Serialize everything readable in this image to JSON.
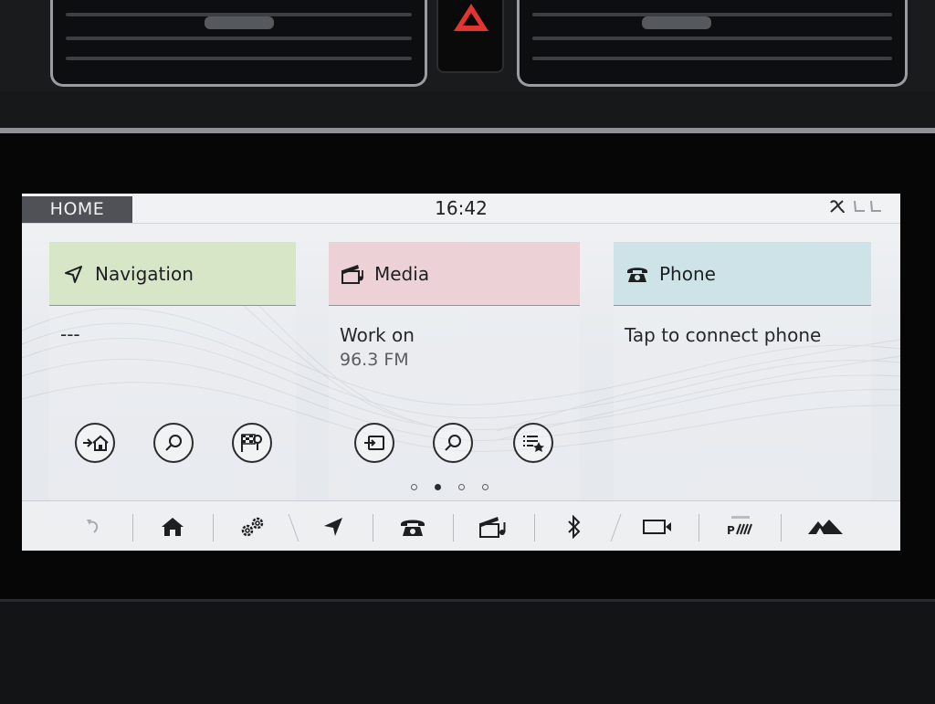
{
  "status_bar": {
    "home_label": "HOME",
    "time": "16:42"
  },
  "cards": {
    "navigation": {
      "title": "Navigation",
      "line1": "---",
      "color": "#d7e6c7"
    },
    "media": {
      "title": "Media",
      "line1": "Work on",
      "line2": "96.3 FM",
      "color": "#ecd2d7"
    },
    "phone": {
      "title": "Phone",
      "line1": "Tap to connect phone",
      "color": "#cde3e8"
    }
  },
  "card_buttons": {
    "navigation": [
      "navigate-home-icon",
      "search-icon",
      "destination-flag-icon"
    ],
    "media": [
      "source-input-icon",
      "search-icon",
      "favorites-list-icon"
    ]
  },
  "pager": {
    "pages": 4,
    "active_index": 1
  },
  "bottom_bar": [
    "back-icon",
    "home-icon",
    "settings-gears-icon",
    "navigation-arrow-icon",
    "phone-icon",
    "media-clapper-icon",
    "bluetooth-icon",
    "camera-icon",
    "parking-aid-icon",
    "terrain-response-icon"
  ]
}
